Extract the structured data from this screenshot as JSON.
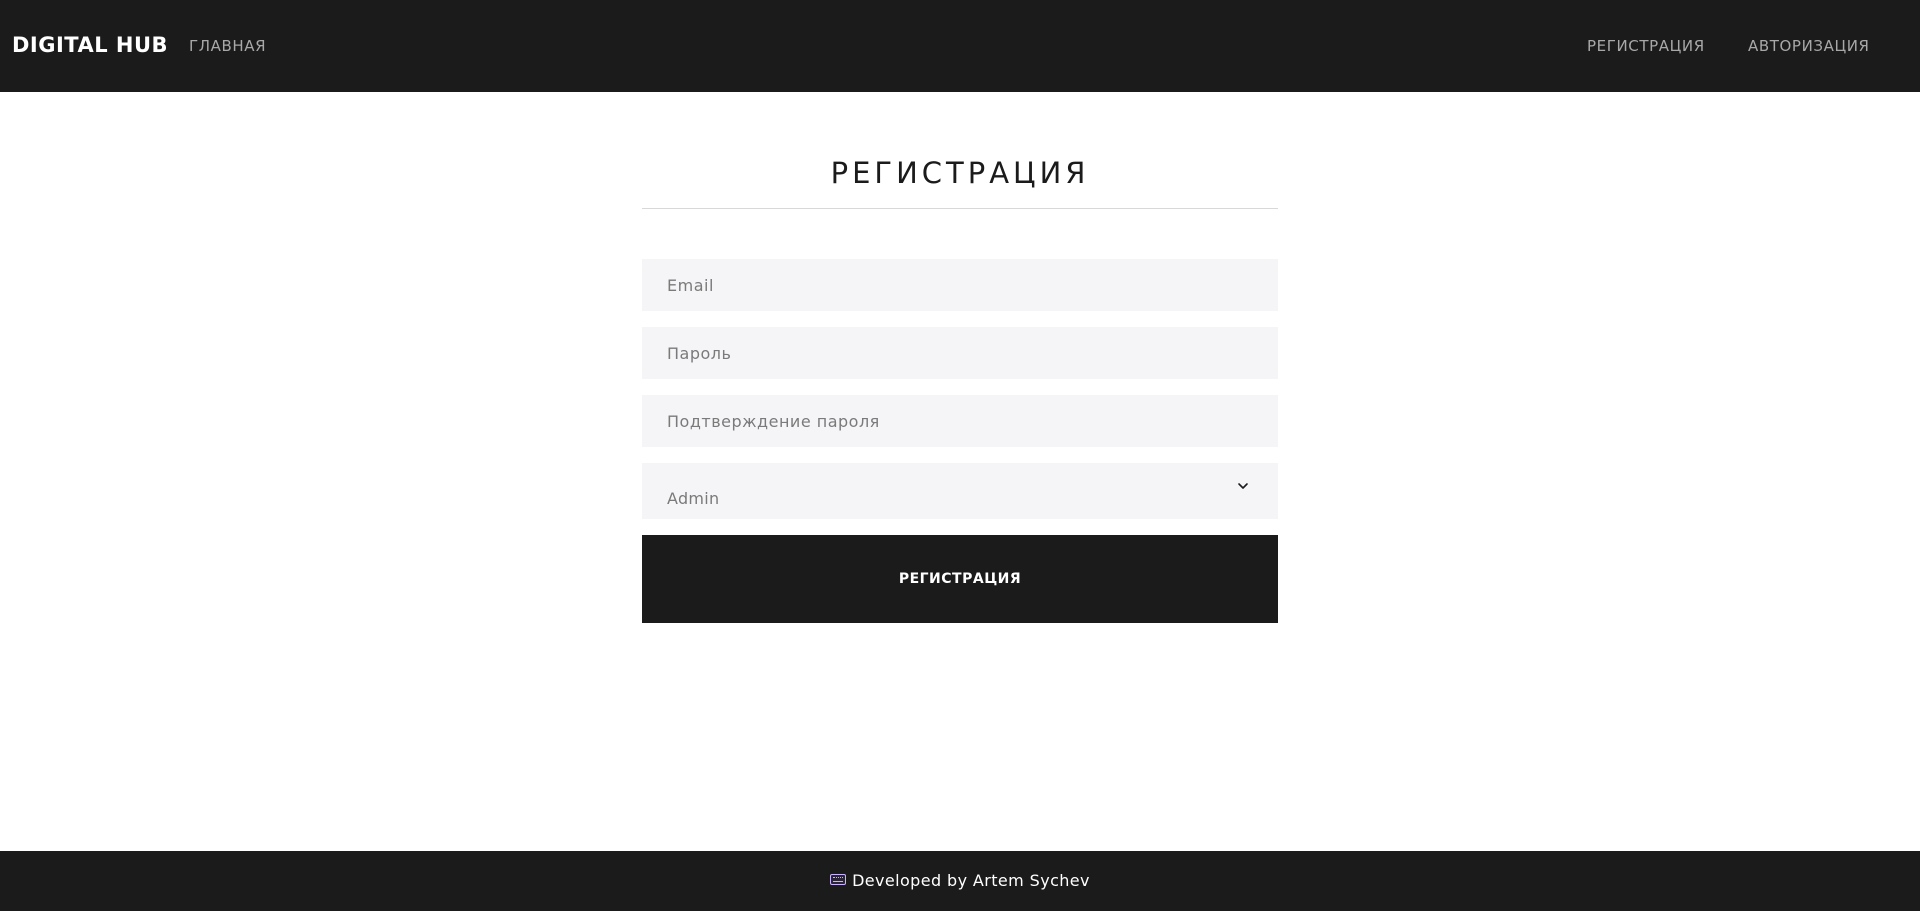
{
  "navbar": {
    "brand": "DIGITAL HUB",
    "home_label": "ГЛАВНАЯ",
    "register_label": "РЕГИСТРАЦИЯ",
    "login_label": "АВТОРИЗАЦИЯ"
  },
  "form": {
    "title": "РЕГИСТРАЦИЯ",
    "email_placeholder": "Email",
    "password_placeholder": "Пароль",
    "confirm_placeholder": "Подтверждение пароля",
    "role_selected": "Admin",
    "submit_label": "РЕГИСТРАЦИЯ"
  },
  "footer": {
    "icon": "keyboard-icon",
    "text": "Developed by Artem Sychev"
  },
  "colors": {
    "dark": "#1b1b1b",
    "field_bg": "#f5f5f7",
    "nav_link": "#a8a8a8"
  }
}
